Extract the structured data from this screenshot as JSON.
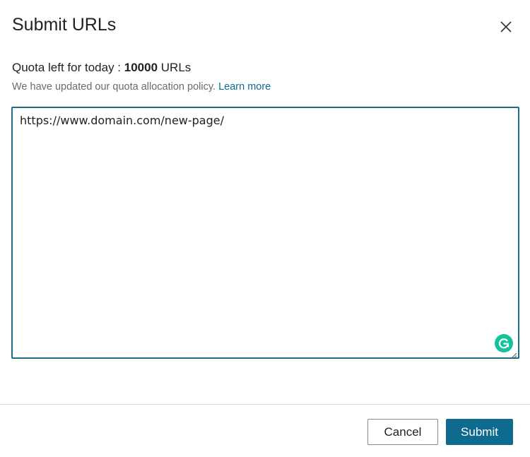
{
  "dialog": {
    "title": "Submit URLs",
    "close_icon": "close-icon"
  },
  "quota": {
    "prefix": "Quota left for today : ",
    "count": "10000",
    "suffix": " URLs"
  },
  "policy": {
    "text": "We have updated our quota allocation policy. ",
    "link_label": "Learn more",
    "link_color": "#0f6b8e"
  },
  "url_input": {
    "value": "https://www.domain.com/new-page/",
    "border_color": "#1b6f82",
    "grammarly_icon": "grammarly-icon"
  },
  "footer": {
    "cancel_label": "Cancel",
    "submit_label": "Submit",
    "submit_color": "#0f6b8e"
  }
}
